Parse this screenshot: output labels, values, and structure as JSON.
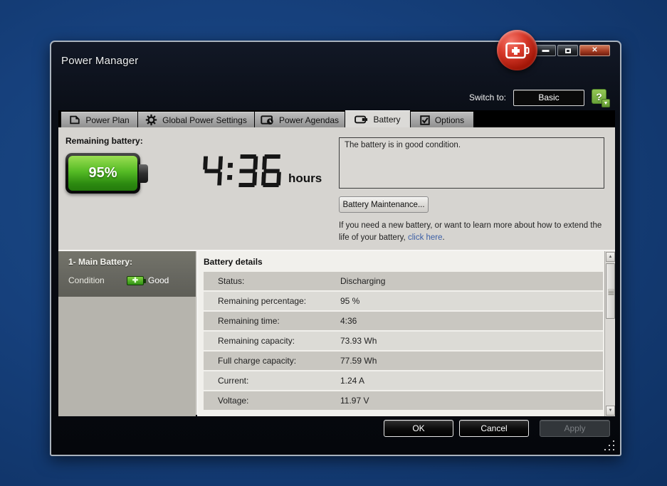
{
  "window": {
    "title": "Power Manager",
    "controls": {
      "minimize": "minimize",
      "maximize": "maximize",
      "close": "x"
    }
  },
  "header": {
    "switch_to_label": "Switch to:",
    "switch_button_label": "Basic",
    "help_glyph": "?"
  },
  "tabs": [
    {
      "label": "Power Plan",
      "icon": "document-icon",
      "active": false
    },
    {
      "label": "Global Power Settings",
      "icon": "gear-icon",
      "active": false
    },
    {
      "label": "Power Agendas",
      "icon": "agenda-clock-icon",
      "active": false
    },
    {
      "label": "Battery",
      "icon": "battery-icon",
      "active": true
    },
    {
      "label": "Options",
      "icon": "checkbox-icon",
      "active": false
    }
  ],
  "battery_overview": {
    "remaining_label": "Remaining battery:",
    "percentage": "95%",
    "time_display": "4:36",
    "time_unit": "hours",
    "condition_text": "The battery is in good condition.",
    "maintenance_button": "Battery Maintenance...",
    "info_text_before_link": "If you need a new battery, or want to learn more about how to extend the life of your battery, ",
    "info_link": "click here",
    "info_text_after_link": "."
  },
  "battery_panel": {
    "title": "1- Main Battery:",
    "condition_label": "Condition",
    "condition_value": "Good"
  },
  "battery_details": {
    "title": "Battery details",
    "rows": [
      {
        "label": "Status:",
        "value": "Discharging"
      },
      {
        "label": "Remaining percentage:",
        "value": "95 %"
      },
      {
        "label": "Remaining time:",
        "value": "4:36"
      },
      {
        "label": "Remaining capacity:",
        "value": "73.93 Wh"
      },
      {
        "label": "Full charge capacity:",
        "value": "77.59 Wh"
      },
      {
        "label": "Current:",
        "value": "1.24 A"
      },
      {
        "label": "Voltage:",
        "value": "11.97 V"
      }
    ]
  },
  "footer": {
    "ok": "OK",
    "cancel": "Cancel",
    "apply": "Apply"
  },
  "colors": {
    "desktop_blue": "#16407c",
    "battery_green": "#55bb25",
    "help_green": "#76b043",
    "close_red": "#a53c22",
    "link_blue": "#3c5fa6"
  }
}
